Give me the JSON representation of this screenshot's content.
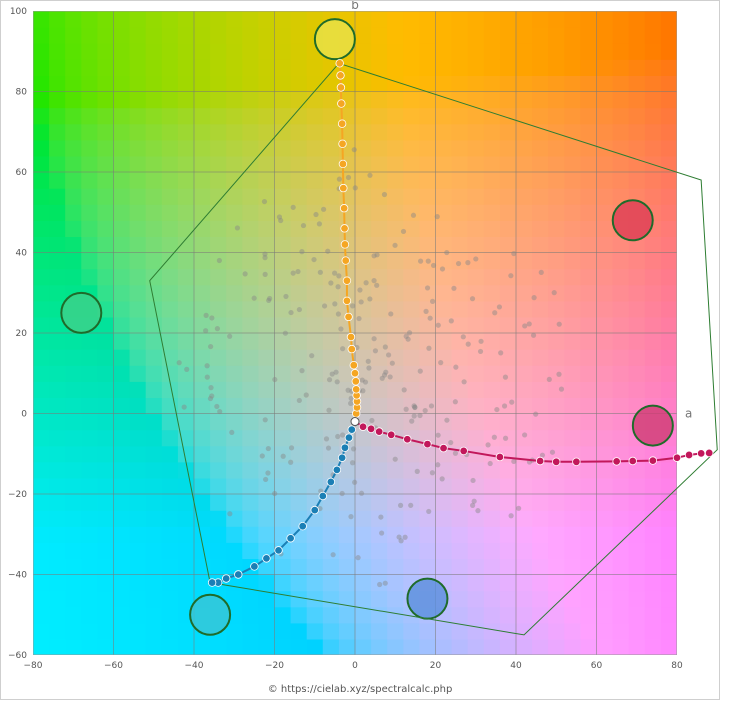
{
  "chart_data": {
    "type": "scatter",
    "title": "",
    "xlabel": "a",
    "ylabel": "b",
    "xlim": [
      -80,
      80
    ],
    "ylim": [
      -60,
      100
    ],
    "x_ticks": [
      -80,
      -60,
      -40,
      -20,
      0,
      20,
      40,
      60,
      80
    ],
    "y_ticks": [
      -60,
      -40,
      -20,
      0,
      20,
      40,
      60,
      80,
      100
    ],
    "grid": true,
    "background": "CIELAB a*b* color plane",
    "gamut_polygon": [
      [
        -4,
        87
      ],
      [
        86,
        58
      ],
      [
        90,
        -9
      ],
      [
        42,
        -55
      ],
      [
        -36,
        -42
      ],
      [
        -51,
        33
      ]
    ],
    "series": [
      {
        "color": "#f5a623",
        "points": [
          [
            0,
            -2
          ],
          [
            0.3,
            0
          ],
          [
            0.5,
            1.5
          ],
          [
            0.5,
            3
          ],
          [
            0.4,
            4.5
          ],
          [
            0.3,
            6
          ],
          [
            0.2,
            8
          ],
          [
            0,
            10
          ],
          [
            -0.3,
            12
          ],
          [
            -0.8,
            16
          ],
          [
            -1,
            19
          ],
          [
            -1.6,
            24
          ],
          [
            -2,
            28
          ],
          [
            -2,
            33
          ],
          [
            -2.3,
            38
          ],
          [
            -2.5,
            42
          ],
          [
            -2.6,
            46
          ],
          [
            -2.7,
            51
          ],
          [
            -2.9,
            56
          ],
          [
            -3,
            62
          ],
          [
            -3.1,
            67
          ],
          [
            -3.2,
            72
          ],
          [
            -3.4,
            77
          ],
          [
            -3.5,
            81
          ],
          [
            -3.6,
            84
          ],
          [
            -3.8,
            87
          ]
        ]
      },
      {
        "color": "#c2185b",
        "points": [
          [
            0,
            -2
          ],
          [
            2,
            -3.3
          ],
          [
            4,
            -3.8
          ],
          [
            6,
            -4.5
          ],
          [
            9,
            -5.3
          ],
          [
            13,
            -6.4
          ],
          [
            18,
            -7.6
          ],
          [
            22,
            -8.6
          ],
          [
            27,
            -9.3
          ],
          [
            36,
            -10.8
          ],
          [
            46,
            -11.8
          ],
          [
            50,
            -12
          ],
          [
            55,
            -12
          ],
          [
            65,
            -11.9
          ],
          [
            69,
            -11.8
          ],
          [
            74,
            -11.7
          ],
          [
            80,
            -11
          ],
          [
            83,
            -10.3
          ],
          [
            86,
            -9.9
          ],
          [
            88,
            -9.8
          ]
        ]
      },
      {
        "color": "#1b7fb5",
        "points": [
          [
            0,
            -2
          ],
          [
            -0.8,
            -4
          ],
          [
            -1.5,
            -6
          ],
          [
            -2.5,
            -8.5
          ],
          [
            -3.2,
            -11
          ],
          [
            -4.5,
            -14
          ],
          [
            -6,
            -17
          ],
          [
            -8,
            -20.5
          ],
          [
            -10,
            -24
          ],
          [
            -13,
            -28
          ],
          [
            -16,
            -31
          ],
          [
            -19,
            -34
          ],
          [
            -22,
            -36
          ],
          [
            -25,
            -38
          ],
          [
            -29,
            -40
          ],
          [
            -32,
            -41
          ],
          [
            -34,
            -42
          ],
          [
            -35.5,
            -42
          ]
        ]
      }
    ],
    "white_point": [
      0,
      -2
    ],
    "reference_circles": [
      {
        "x": -5,
        "y": 93,
        "color": "#e8e24a"
      },
      {
        "x": 69,
        "y": 48,
        "color": "#dd3d55"
      },
      {
        "x": -68,
        "y": 25,
        "color": "#3dd18a"
      },
      {
        "x": 74,
        "y": -3,
        "color": "#d03c73"
      },
      {
        "x": 18,
        "y": -46,
        "color": "#5a8edc"
      },
      {
        "x": -36,
        "y": -50,
        "color": "#38c6d6"
      }
    ],
    "background_scatter_color": "#888888",
    "credit": "© https://cielab.xyz/spectralcalc.php"
  }
}
